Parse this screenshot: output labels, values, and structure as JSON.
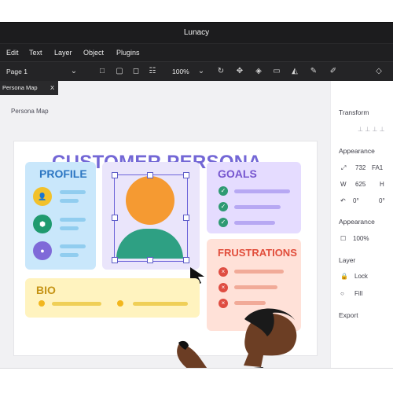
{
  "window": {
    "title": "Lunacy"
  },
  "menubar": {
    "items": [
      "Edit",
      "Text",
      "Layer",
      "Object",
      "Plugins"
    ]
  },
  "toolbar": {
    "page_selector": "Page 1",
    "zoom": "100%"
  },
  "tabs": [
    {
      "label": "Persona Map",
      "close": "X"
    }
  ],
  "canvas": {
    "frame_label": "Persona Map"
  },
  "right_panel": {
    "sections": {
      "transform": "Transform",
      "appearance": "Appearance",
      "appearance_2": "Appearance",
      "layer": "Layer",
      "export": "Export"
    },
    "appearance": {
      "x": "732",
      "fa": "FA1",
      "w_label": "W",
      "w_value": "625",
      "h_label": "H",
      "rotation_1": "0°",
      "rotation_2": "0°"
    },
    "opacity": "100%",
    "layer_items": [
      "Lock",
      "Fill"
    ]
  },
  "design": {
    "heading": "CUSTOMER PERSONA",
    "profile": "PROFILE",
    "goals": "GOALS",
    "frustrations": "FRUSTRATIONS",
    "bio": "BIO"
  },
  "colors": {
    "accent": "#7367d6",
    "profile_bg": "#c9e7fb",
    "goals_bg": "#e5dcff",
    "frustrations_bg": "#ffe1d8",
    "bio_bg": "#fff3bf",
    "avatar_orange": "#f59a32",
    "avatar_green": "#2ea083"
  }
}
